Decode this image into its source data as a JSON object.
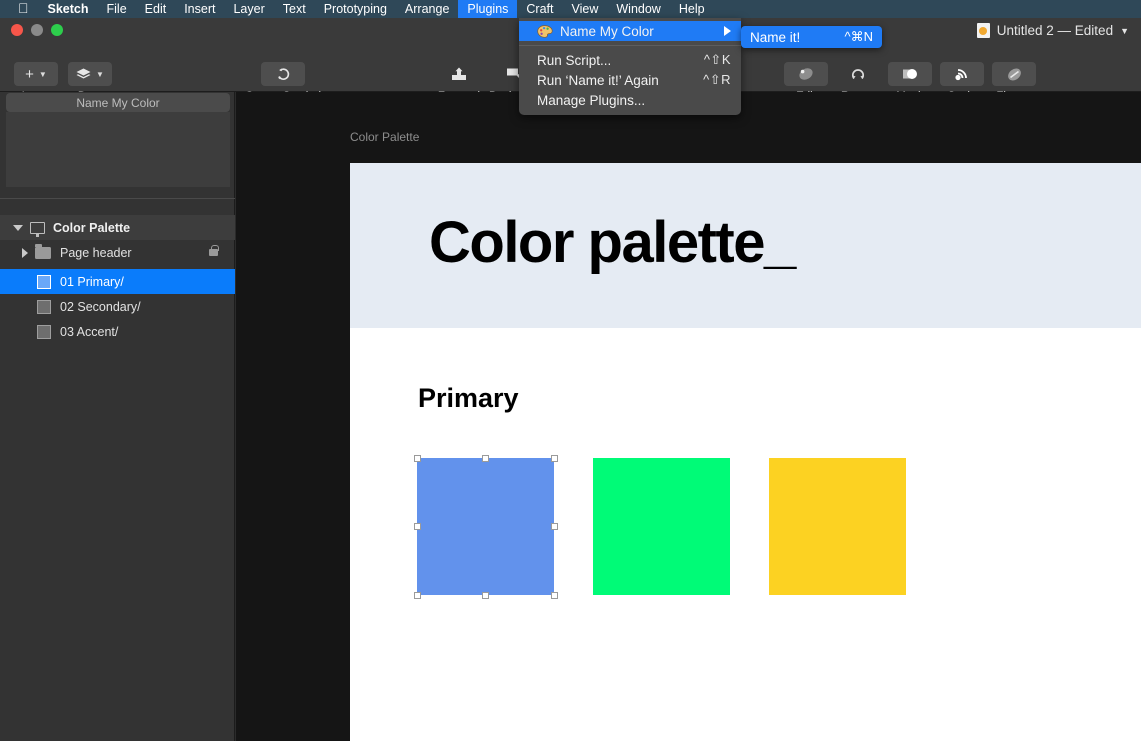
{
  "menubar": {
    "apple_icon": "apple-logo-icon",
    "items": [
      {
        "label": "Sketch",
        "bold": true,
        "active": false
      },
      {
        "label": "File",
        "bold": false,
        "active": false
      },
      {
        "label": "Edit",
        "bold": false,
        "active": false
      },
      {
        "label": "Insert",
        "bold": false,
        "active": false
      },
      {
        "label": "Layer",
        "bold": false,
        "active": false
      },
      {
        "label": "Text",
        "bold": false,
        "active": false
      },
      {
        "label": "Prototyping",
        "bold": false,
        "active": false
      },
      {
        "label": "Arrange",
        "bold": false,
        "active": false
      },
      {
        "label": "Plugins",
        "bold": false,
        "active": true
      },
      {
        "label": "Craft",
        "bold": false,
        "active": false
      },
      {
        "label": "View",
        "bold": false,
        "active": false
      },
      {
        "label": "Window",
        "bold": false,
        "active": false
      },
      {
        "label": "Help",
        "bold": false,
        "active": false
      }
    ]
  },
  "plugins_menu": {
    "highlighted_item": {
      "label": "Name My Color",
      "icon": "color-palette-icon",
      "has_submenu": true
    },
    "items": [
      {
        "label": "Run Script...",
        "shortcut": "^⇧K"
      },
      {
        "label": "Run ‘Name it!’ Again",
        "shortcut": "^⇧R"
      },
      {
        "label": "Manage Plugins...",
        "shortcut": ""
      }
    ],
    "submenu": {
      "label": "Name it!",
      "shortcut": "^⌘N"
    }
  },
  "toolbar": {
    "groups": [
      {
        "label": "Insert",
        "icon": "plus-icon",
        "has_caret": true
      },
      {
        "label": "Data",
        "icon": "layers-stack-icon",
        "has_caret": true
      },
      {
        "label": "Create Symbol",
        "icon": "create-symbol-icon",
        "has_caret": false
      },
      {
        "label": "Forward",
        "icon": "bring-forward-icon",
        "has_caret": false
      },
      {
        "label": "Backward",
        "icon": "send-backward-icon",
        "has_caret": false
      },
      {
        "label": "Edit",
        "icon": "edit-icon",
        "has_caret": false
      },
      {
        "label": "Rotate",
        "icon": "rotate-icon",
        "has_caret": false
      },
      {
        "label": "Mask",
        "icon": "mask-icon",
        "has_caret": false
      },
      {
        "label": "Scale",
        "icon": "scale-icon",
        "has_caret": false
      },
      {
        "label": "Flatten",
        "icon": "flatten-icon",
        "has_caret": false
      }
    ]
  },
  "document": {
    "title": "Untitled 2 — Edited",
    "chevron": "chevron-down-icon"
  },
  "sidebar": {
    "plugin_panel_title": "Name My Color",
    "artboard": {
      "label": "Color Palette",
      "icon": "artboard-icon"
    },
    "layers": [
      {
        "label": "Page header",
        "type": "group",
        "selected": false,
        "locked": true
      },
      {
        "label": "01 Primary/",
        "type": "rect",
        "selected": true,
        "locked": false
      },
      {
        "label": "02 Secondary/",
        "type": "rect",
        "selected": false,
        "locked": false
      },
      {
        "label": "03 Accent/",
        "type": "rect",
        "selected": false,
        "locked": false
      }
    ]
  },
  "canvas": {
    "artboard_name": "Color Palette",
    "header_title": "Color palette_",
    "header_bg": "#e5ebf3",
    "section_heading": "Primary",
    "swatches": [
      {
        "name": "01 Primary",
        "color": "#6292ec",
        "selected": true
      },
      {
        "name": "02 Secondary",
        "color": "#00fb77",
        "selected": false
      },
      {
        "name": "03 Accent",
        "color": "#fcd222",
        "selected": false
      }
    ]
  },
  "colors": {
    "menubar_bg": "#2f4858",
    "accent_blue": "#1f7bf5",
    "selection_blue": "#0a7cfb",
    "toolbar_bg": "#3a3a3a",
    "sidebar_bg": "#333333",
    "canvas_bg": "#151515"
  }
}
